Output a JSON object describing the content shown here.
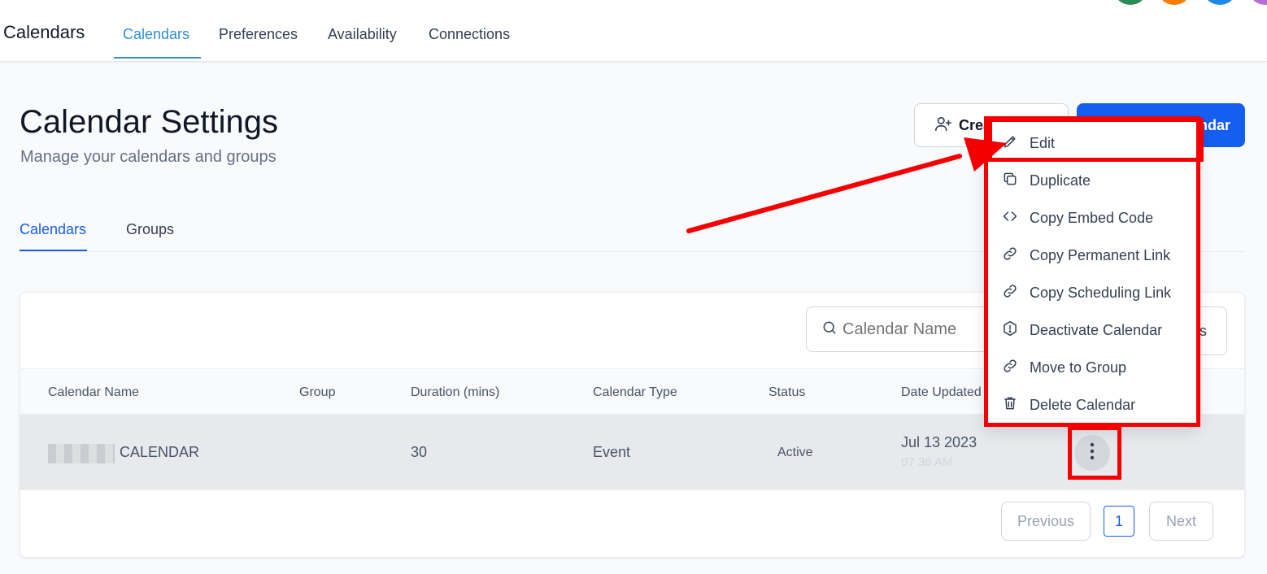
{
  "topnav": {
    "app_title": "Calendars",
    "tabs": [
      {
        "label": "Calendars",
        "active": true
      },
      {
        "label": "Preferences",
        "active": false
      },
      {
        "label": "Availability",
        "active": false
      },
      {
        "label": "Connections",
        "active": false
      }
    ],
    "avatar_colors": [
      "#2e8b57",
      "#ff7a00",
      "#1e88e5",
      "#b36fd6"
    ]
  },
  "header": {
    "title": "Calendar Settings",
    "subtitle": "Manage your calendars and groups",
    "create_group_button": "Crea",
    "create_calendar_button": "ndar"
  },
  "subtabs": [
    {
      "label": "Calendars",
      "active": true
    },
    {
      "label": "Groups",
      "active": false
    }
  ],
  "toolbar": {
    "search_placeholder": "Calendar Name",
    "filters_button": "rs"
  },
  "table": {
    "columns": [
      "Calendar Name",
      "Group",
      "Duration (mins)",
      "Calendar Type",
      "Status",
      "Date Updated"
    ],
    "rows": [
      {
        "name": "CALENDAR",
        "group": "",
        "duration": "30",
        "type": "Event",
        "status": "Active",
        "date": "Jul 13 2023",
        "time": "07 36 AM"
      }
    ]
  },
  "pagination": {
    "previous": "Previous",
    "page": "1",
    "next": "Next"
  },
  "row_menu": {
    "items": [
      {
        "label": "Edit",
        "icon": "pencil-icon"
      },
      {
        "label": "Duplicate",
        "icon": "copy-icon"
      },
      {
        "label": "Copy Embed Code",
        "icon": "code-icon"
      },
      {
        "label": "Copy Permanent Link",
        "icon": "link-icon"
      },
      {
        "label": "Copy Scheduling Link",
        "icon": "link-icon"
      },
      {
        "label": "Deactivate Calendar",
        "icon": "alert-hexagon-icon"
      },
      {
        "label": "Move to Group",
        "icon": "link-icon"
      },
      {
        "label": "Delete Calendar",
        "icon": "trash-icon"
      }
    ]
  },
  "colors": {
    "primary": "#155eef",
    "nav_active": "#2f8fd0",
    "annotation": "#f40000"
  }
}
